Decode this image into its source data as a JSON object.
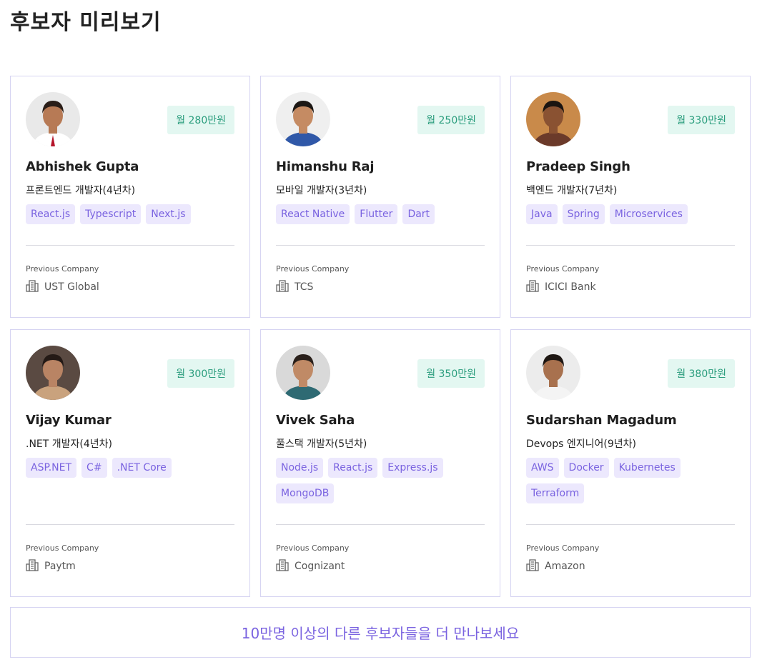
{
  "page": {
    "title": "후보자 미리보기"
  },
  "labels": {
    "previous_company": "Previous Company"
  },
  "colors": {
    "accent": "#7a63e0",
    "salary_bg": "#e3f7f1",
    "salary_text": "#2a9d7d",
    "tag_bg": "#ece8fd",
    "border": "#d6d4f2"
  },
  "candidates": [
    {
      "name": "Abhishek Gupta",
      "salary": "월 280만원",
      "role": "프론트엔드 개발자(4년차)",
      "tags": [
        "React.js",
        "Typescript",
        "Next.js"
      ],
      "company": "UST Global"
    },
    {
      "name": "Himanshu Raj",
      "salary": "월 250만원",
      "role": "모바일 개발자(3년차)",
      "tags": [
        "React Native",
        "Flutter",
        "Dart"
      ],
      "company": "TCS"
    },
    {
      "name": "Pradeep Singh",
      "salary": "월 330만원",
      "role": "백엔드 개발자(7년차)",
      "tags": [
        "Java",
        "Spring",
        "Microservices"
      ],
      "company": "ICICI Bank"
    },
    {
      "name": "Vijay Kumar",
      "salary": "월 300만원",
      "role": ".NET 개발자(4년차)",
      "tags": [
        "ASP.NET",
        "C#",
        ".NET Core"
      ],
      "company": "Paytm"
    },
    {
      "name": "Vivek Saha",
      "salary": "월 350만원",
      "role": "풀스택 개발자(5년차)",
      "tags": [
        "Node.js",
        "React.js",
        "Express.js",
        "MongoDB"
      ],
      "company": "Cognizant"
    },
    {
      "name": "Sudarshan Magadum",
      "salary": "월 380만원",
      "role": "Devops 엔지니어(9년차)",
      "tags": [
        "AWS",
        "Docker",
        "Kubernetes",
        "Terraform"
      ],
      "company": "Amazon"
    }
  ],
  "more_button": {
    "label": "10만명 이상의 다른 후보자들을 더 만나보세요"
  }
}
